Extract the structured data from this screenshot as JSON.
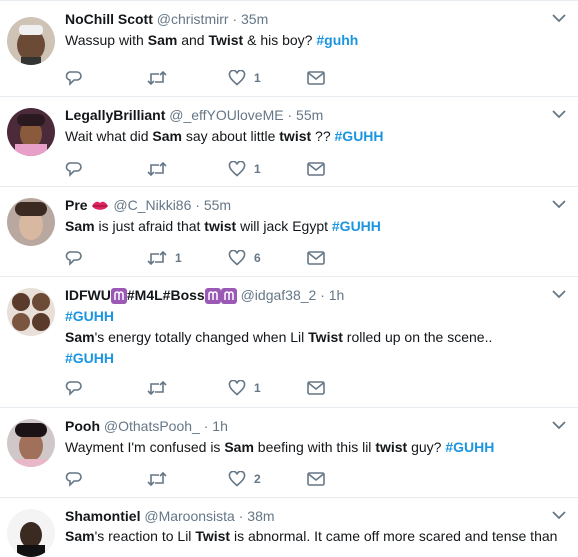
{
  "tweets": [
    {
      "name": "NoChill Scott",
      "handle": "@christmirr",
      "sep": "·",
      "time": "35m",
      "segments": [
        {
          "t": "Wassup with ",
          "s": "n"
        },
        {
          "t": "Sam",
          "s": "b"
        },
        {
          "t": " and ",
          "s": "n"
        },
        {
          "t": "Twist",
          "s": "b"
        },
        {
          "t": " & his boy? ",
          "s": "n"
        },
        {
          "t": "#guhh",
          "s": "tag"
        }
      ],
      "reply_count": "",
      "retweet_count": "",
      "like_count": "1"
    },
    {
      "name": "LegallyBrilliant",
      "handle": "@_effYOUloveME",
      "sep": "·",
      "time": "55m",
      "segments": [
        {
          "t": "Wait what did ",
          "s": "n"
        },
        {
          "t": "Sam",
          "s": "b"
        },
        {
          "t": " say about little ",
          "s": "n"
        },
        {
          "t": "twist",
          "s": "b"
        },
        {
          "t": " ?? ",
          "s": "n"
        },
        {
          "t": "#GUHH",
          "s": "tag"
        }
      ],
      "reply_count": "",
      "retweet_count": "",
      "like_count": "1"
    },
    {
      "name": "Pre",
      "handle": "@C_Nikki86",
      "sep": "·",
      "time": "55m",
      "segments": [
        {
          "t": "Sam",
          "s": "b"
        },
        {
          "t": " is just afraid that ",
          "s": "n"
        },
        {
          "t": "twist",
          "s": "b"
        },
        {
          "t": " will jack Egypt ",
          "s": "n"
        },
        {
          "t": "#GUHH",
          "s": "tag"
        }
      ],
      "reply_count": "",
      "retweet_count": "1",
      "like_count": "6"
    },
    {
      "name": "IDFWU",
      "name_part2": "#M4L#Boss",
      "handle": "@idgaf38_2",
      "sep": "·",
      "time": "1h",
      "line1_tag": "#GUHH",
      "segments": [
        {
          "t": "Sam",
          "s": "b"
        },
        {
          "t": "'s energy totally changed when Lil ",
          "s": "n"
        },
        {
          "t": "Twist",
          "s": "b"
        },
        {
          "t": " rolled up on the scene..",
          "s": "n"
        }
      ],
      "line3_tag": "#GUHH",
      "reply_count": "",
      "retweet_count": "",
      "like_count": "1"
    },
    {
      "name": "Pooh",
      "handle": "@OthatsPooh_",
      "sep": "·",
      "time": "1h",
      "segments": [
        {
          "t": "Wayment I'm confused is ",
          "s": "n"
        },
        {
          "t": "Sam",
          "s": "b"
        },
        {
          "t": " beefing with this lil ",
          "s": "n"
        },
        {
          "t": "twist",
          "s": "b"
        },
        {
          "t": " guy? ",
          "s": "n"
        },
        {
          "t": "#GUHH",
          "s": "tag"
        }
      ],
      "reply_count": "",
      "retweet_count": "",
      "like_count": "2"
    },
    {
      "name": "Shamontiel",
      "handle": "@Maroonsista",
      "sep": "·",
      "time": "38m",
      "segments": [
        {
          "t": "Sam",
          "s": "b"
        },
        {
          "t": "'s reaction to Lil ",
          "s": "n"
        },
        {
          "t": "Twist",
          "s": "b"
        },
        {
          "t": " is abnormal. It came off more scared and tense than",
          "s": "n"
        }
      ]
    }
  ],
  "icons": {
    "reply": "reply-icon",
    "retweet": "retweet-icon",
    "like": "heart-icon",
    "dm": "envelope-icon",
    "caret": "chevron-down-icon"
  },
  "colors": {
    "hashtag": "#1b95e0",
    "meta": "#657786",
    "divider": "#e6ecf0"
  }
}
